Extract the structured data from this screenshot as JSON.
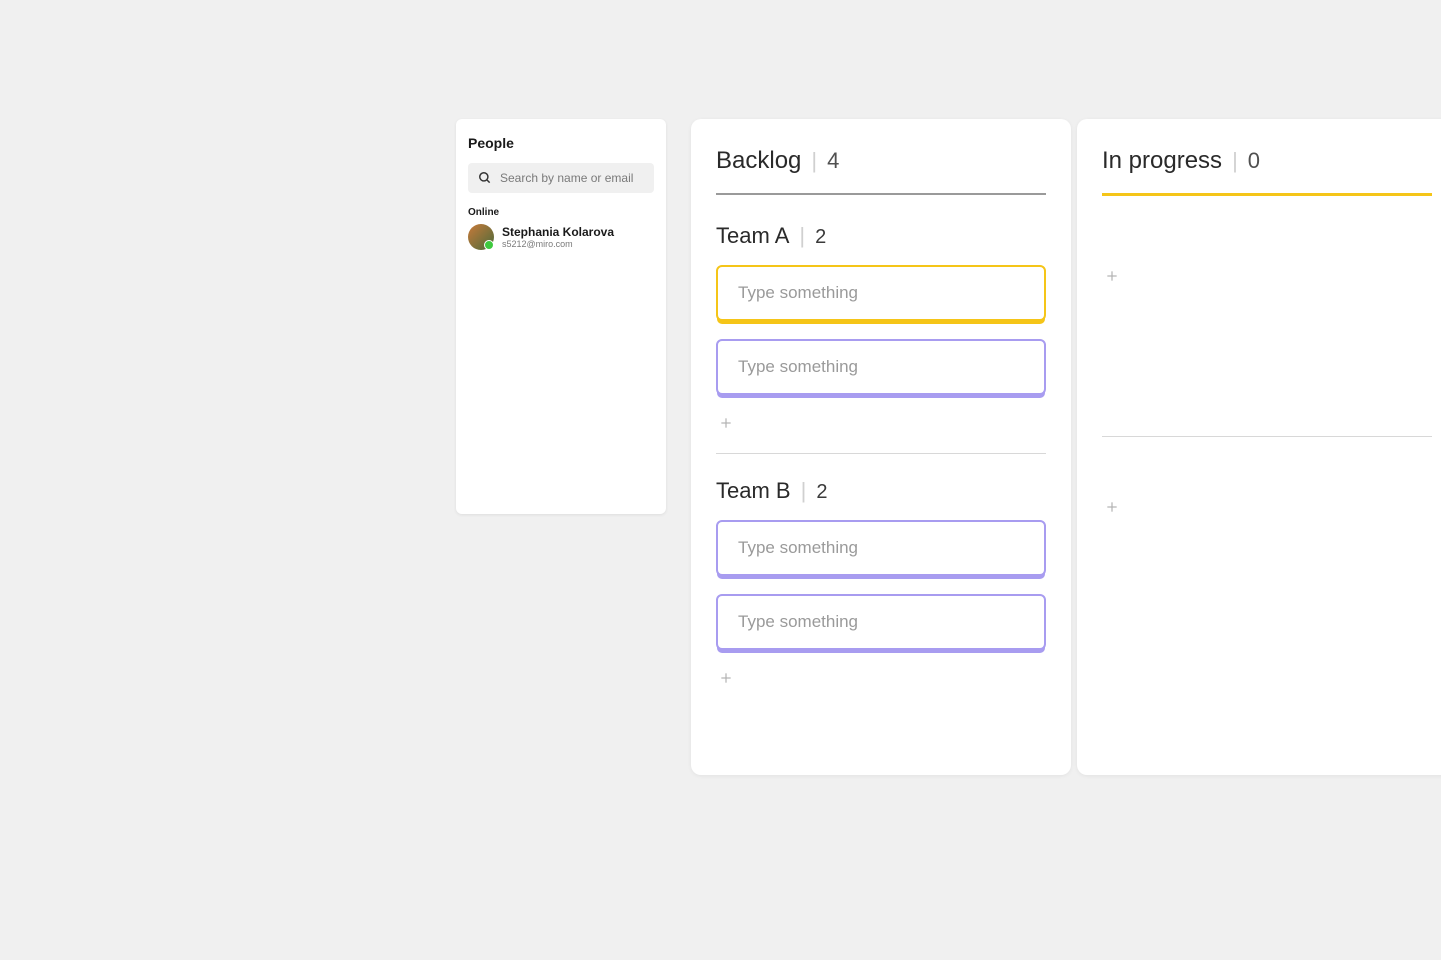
{
  "people_panel": {
    "title": "People",
    "search_placeholder": "Search by name or email",
    "online_label": "Online",
    "users": [
      {
        "name": "Stephania Kolarova",
        "email": "s5212@miro.com"
      }
    ]
  },
  "columns": [
    {
      "title": "Backlog",
      "count": "4",
      "accent": "gray",
      "swimlanes": [
        {
          "title": "Team A",
          "count": "2",
          "cards": [
            {
              "placeholder": "Type something",
              "color": "yellow"
            },
            {
              "placeholder": "Type something",
              "color": "purple"
            }
          ]
        },
        {
          "title": "Team B",
          "count": "2",
          "cards": [
            {
              "placeholder": "Type something",
              "color": "purple"
            },
            {
              "placeholder": "Type something",
              "color": "purple"
            }
          ]
        }
      ]
    },
    {
      "title": "In progress",
      "count": "0",
      "accent": "yellow",
      "swimlanes": [
        {
          "cards": []
        },
        {
          "cards": []
        }
      ]
    }
  ]
}
